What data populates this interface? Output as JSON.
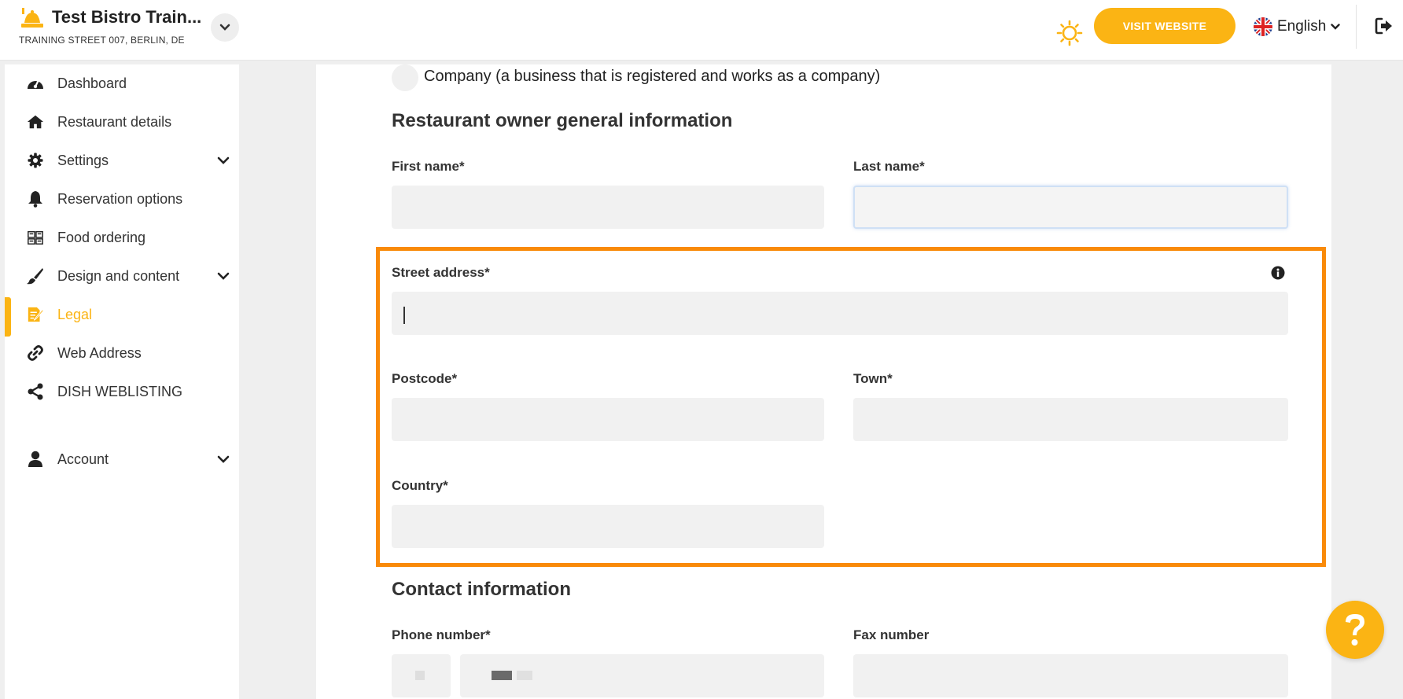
{
  "header": {
    "restaurant_name": "Test Bistro Train...",
    "restaurant_address": "TRAINING STREET 007, BERLIN, DE",
    "visit_website_label": "VISIT WEBSITE",
    "language_label": "English",
    "accent_color": "#fbb414"
  },
  "sidebar": {
    "items": [
      {
        "label": "Dashboard",
        "icon": "dashboard-gauge-icon"
      },
      {
        "label": "Restaurant details",
        "icon": "home-icon"
      },
      {
        "label": "Settings",
        "icon": "gear-icon"
      },
      {
        "label": "Reservation options",
        "icon": "bell-icon"
      },
      {
        "label": "Food ordering",
        "icon": "food-ordering-icon"
      },
      {
        "label": "Design and content",
        "icon": "paintbrush-icon"
      },
      {
        "label": "Legal",
        "icon": "legal-document-icon"
      },
      {
        "label": "Web Address",
        "icon": "link-icon"
      },
      {
        "label": "DISH WEBLISTING",
        "icon": "share-icon"
      },
      {
        "label": "Account",
        "icon": "user-icon"
      }
    ],
    "active_item": "Legal"
  },
  "form": {
    "company_option_label": "Company (a business that is registered and works as a company)",
    "owner_section_title": "Restaurant owner general information",
    "first_name_label": "First name*",
    "first_name_value": "",
    "last_name_label": "Last name*",
    "last_name_value": "",
    "street_label": "Street address*",
    "street_value": "",
    "postcode_label": "Postcode*",
    "postcode_value": "",
    "town_label": "Town*",
    "town_value": "",
    "country_label": "Country*",
    "country_value": "",
    "contact_section_title": "Contact information",
    "phone_label": "Phone number*",
    "fax_label": "Fax number",
    "fax_value": ""
  },
  "colors": {
    "highlight": "#f98a09",
    "accent": "#fbb414"
  }
}
